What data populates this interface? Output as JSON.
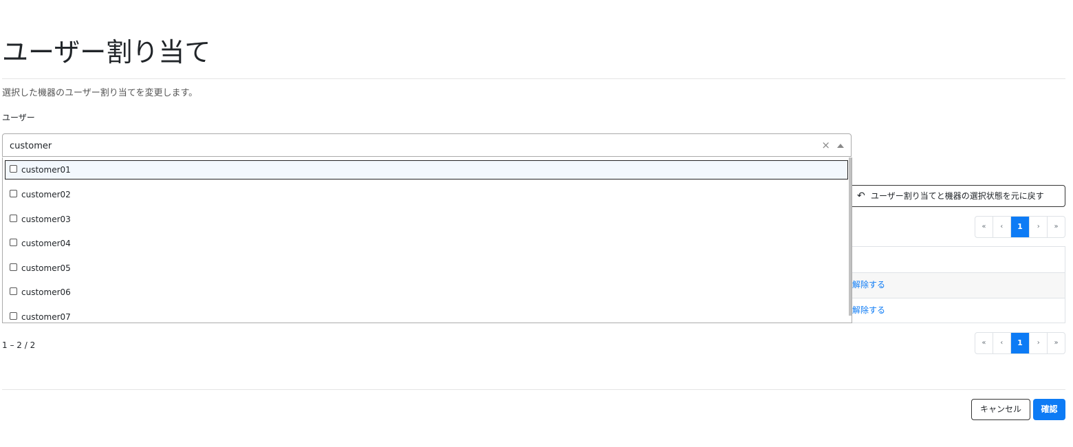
{
  "page": {
    "title": "ユーザー割り当て",
    "description": "選択した機器のユーザー割り当てを変更します。"
  },
  "user_field": {
    "label": "ユーザー",
    "value": "customer",
    "clear_icon": "×",
    "options": [
      {
        "label": "customer01",
        "checked": false,
        "highlighted": true
      },
      {
        "label": "customer02",
        "checked": false
      },
      {
        "label": "customer03",
        "checked": false
      },
      {
        "label": "customer04",
        "checked": false
      },
      {
        "label": "customer05",
        "checked": false
      },
      {
        "label": "customer06",
        "checked": false
      },
      {
        "label": "customer07",
        "checked": false
      }
    ]
  },
  "toolbar": {
    "restore_label": "ユーザー割り当てと機器の選択状態を元に戻す",
    "restore_icon": "undo-icon"
  },
  "pagination": {
    "first": "«",
    "prev": "‹",
    "current": "1",
    "next": "›",
    "last": "»"
  },
  "table": {
    "rows": [
      {
        "action": "解除する"
      },
      {
        "action": "解除する"
      }
    ]
  },
  "range_text": "1 – 2 / 2",
  "footer": {
    "cancel_label": "キャンセル",
    "confirm_label": "確認"
  },
  "colors": {
    "primary": "#0d7bf5",
    "text": "#212529",
    "border": "#dee2e6"
  }
}
